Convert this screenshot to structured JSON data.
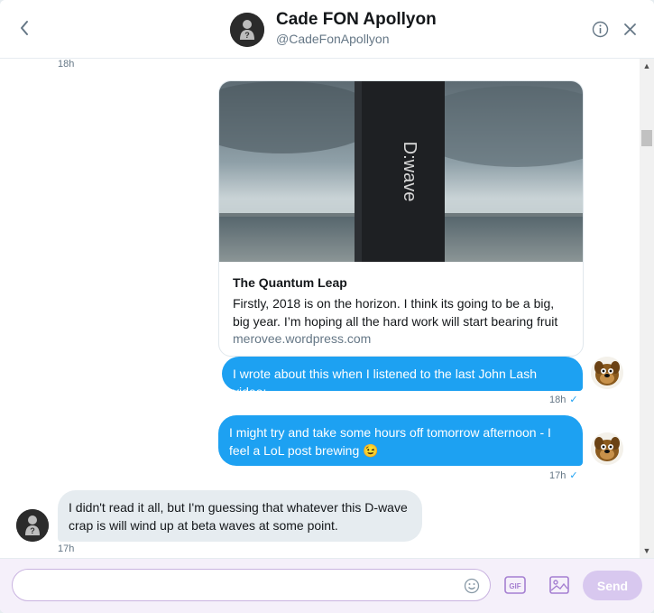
{
  "header": {
    "name": "Cade FON Apollyon",
    "handle": "@CadeFonApollyon"
  },
  "conversation": {
    "top_timestamp": "18h",
    "card": {
      "title": "The Quantum Leap",
      "description": "Firstly, 2018 is on the horizon. I think its going to be a big, big year. I’m hoping all the hard work will start bearing fruit",
      "domain": "merovee.wordpress.com",
      "image_text": "D:wave"
    },
    "messages": [
      {
        "text": "I wrote about this when I listened to the last John Lash video:",
        "timestamp": "18h",
        "check": "✓"
      },
      {
        "text": "I might try and take some hours off tomorrow afternoon - I feel a LoL post brewing 😉",
        "timestamp": "17h",
        "check": "✓"
      },
      {
        "text": "I didn't read it all, but I'm guessing that whatever this D-wave crap is will wind up at beta waves at some point.",
        "timestamp": "17h"
      }
    ]
  },
  "composer": {
    "placeholder": "",
    "gif_label": "GIF",
    "send_label": "Send"
  },
  "colors": {
    "accent": "#1da1f2",
    "incoming_bubble": "#e6ecf0",
    "send_disabled": "#d8c8ef",
    "composer_bg": "#f5f0fa"
  },
  "icons": [
    "back-arrow-icon",
    "info-icon",
    "close-icon",
    "emoji-icon",
    "gif-icon",
    "media-icon"
  ]
}
